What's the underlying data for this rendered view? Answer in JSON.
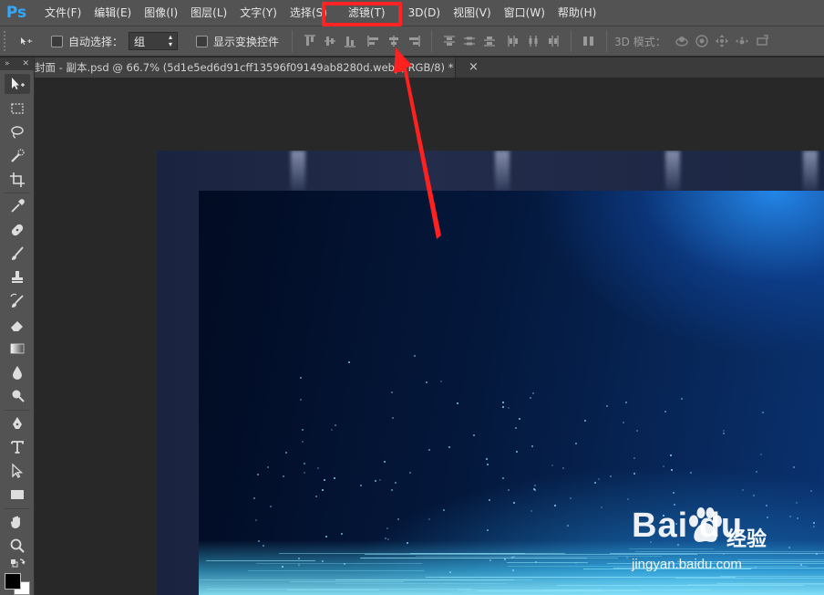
{
  "app": {
    "logo": "Ps"
  },
  "menu": {
    "items": [
      "文件(F)",
      "编辑(E)",
      "图像(I)",
      "图层(L)",
      "文字(Y)",
      "选择(S)",
      "滤镜(T)",
      "3D(D)",
      "视图(V)",
      "窗口(W)",
      "帮助(H)"
    ]
  },
  "options": {
    "auto_select_label": "自动选择：",
    "auto_select_value": "组",
    "show_transform_label": "显示变换控件",
    "mode_3d_label": "3D 模式："
  },
  "document": {
    "tab_title": "封面 - 副本.psd @ 66.7% (5d1e5ed6d91cff13596f09149ab8280d.webp, RGB/8) *",
    "close_symbol": "×"
  },
  "annotation": {
    "highlighted_menu": "滤镜(T)",
    "color": "#ff2424"
  },
  "watermark": {
    "logo": "Bai  du",
    "cn": "经验",
    "url": "jingyan.baidu.com"
  },
  "colors": {
    "foreground": "#000000",
    "background": "#ffffff",
    "accent": "#31a8ff"
  }
}
